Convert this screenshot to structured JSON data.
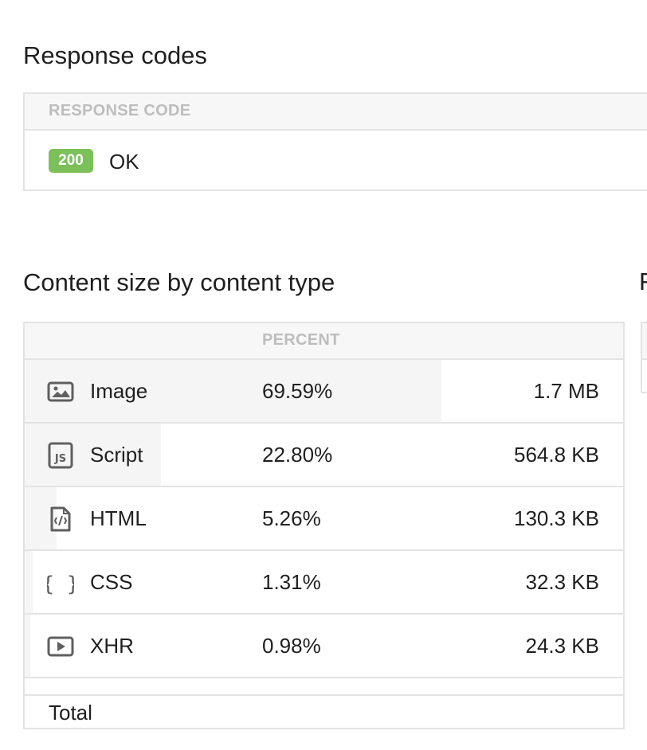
{
  "response_codes": {
    "title": "Response codes",
    "column_header": "RESPONSE CODE",
    "rows": [
      {
        "code": "200",
        "label": "OK",
        "badge_color": "#7cc05a"
      }
    ]
  },
  "content_size": {
    "title": "Content size by content type",
    "column_header": "PERCENT",
    "rows": [
      {
        "type": "Image",
        "icon": "image-icon",
        "percent": "69.59%",
        "size": "1.7 MB",
        "share": 0.6959
      },
      {
        "type": "Script",
        "icon": "js-file-icon",
        "percent": "22.80%",
        "size": "564.8 KB",
        "share": 0.228
      },
      {
        "type": "HTML",
        "icon": "html-file-icon",
        "percent": "5.26%",
        "size": "130.3 KB",
        "share": 0.0526
      },
      {
        "type": "CSS",
        "icon": "css-braces-icon",
        "percent": "1.31%",
        "size": "32.3 KB",
        "share": 0.0131
      },
      {
        "type": "XHR",
        "icon": "play-icon",
        "percent": "0.98%",
        "size": "24.3 KB",
        "share": 0.0098
      }
    ],
    "total_label": "Total"
  },
  "next_panel": {
    "title_fragment": "F"
  },
  "colors": {
    "bar_fill": "#f5f5f5",
    "border": "#e3e3e3",
    "header_text": "#bdbdbd",
    "icon": "#5f5f5f"
  }
}
